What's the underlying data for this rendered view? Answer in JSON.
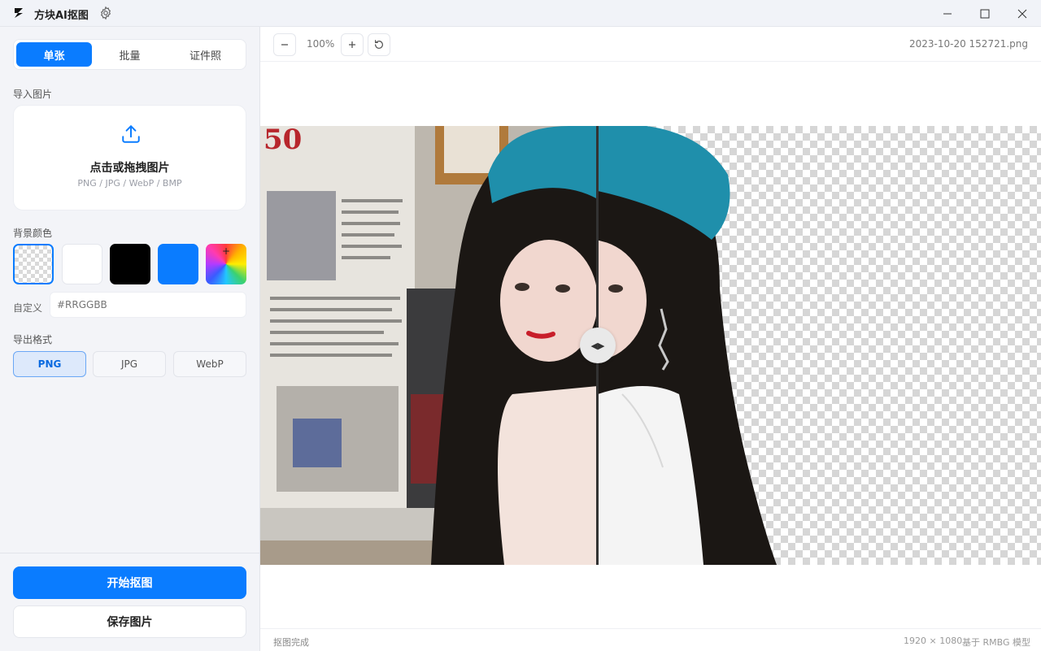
{
  "app": {
    "title": "方块AI抠图"
  },
  "sidebar": {
    "tabs": [
      {
        "label": "单张",
        "active": true
      },
      {
        "label": "批量",
        "active": false
      },
      {
        "label": "证件照",
        "active": false
      }
    ],
    "import_label": "导入图片",
    "upload": {
      "title": "点击或拖拽图片",
      "hint": "PNG / JPG / WebP / BMP"
    },
    "bg_label": "背景颜色",
    "swatches": [
      {
        "name": "transparent",
        "color": "transparent",
        "selected": true
      },
      {
        "name": "white",
        "color": "#ffffff"
      },
      {
        "name": "black",
        "color": "#000000"
      },
      {
        "name": "blue",
        "color": "#0a7cff"
      },
      {
        "name": "custom-gradient",
        "color": "rainbow"
      }
    ],
    "custom_label": "自定义",
    "custom_placeholder": "#RRGGBB",
    "format_label": "导出格式",
    "formats": [
      {
        "label": "PNG",
        "active": true
      },
      {
        "label": "JPG",
        "active": false
      },
      {
        "label": "WebP",
        "active": false
      }
    ],
    "start_button": "开始抠图",
    "save_button": "保存图片"
  },
  "toolbar": {
    "zoom": "100%",
    "file_name": "2023-10-20 152721.png"
  },
  "status": {
    "left": "抠图完成",
    "dimensions": "1920 × 1080",
    "model": "基于 RMBG 模型"
  },
  "colors": {
    "accent": "#0a7cff"
  }
}
